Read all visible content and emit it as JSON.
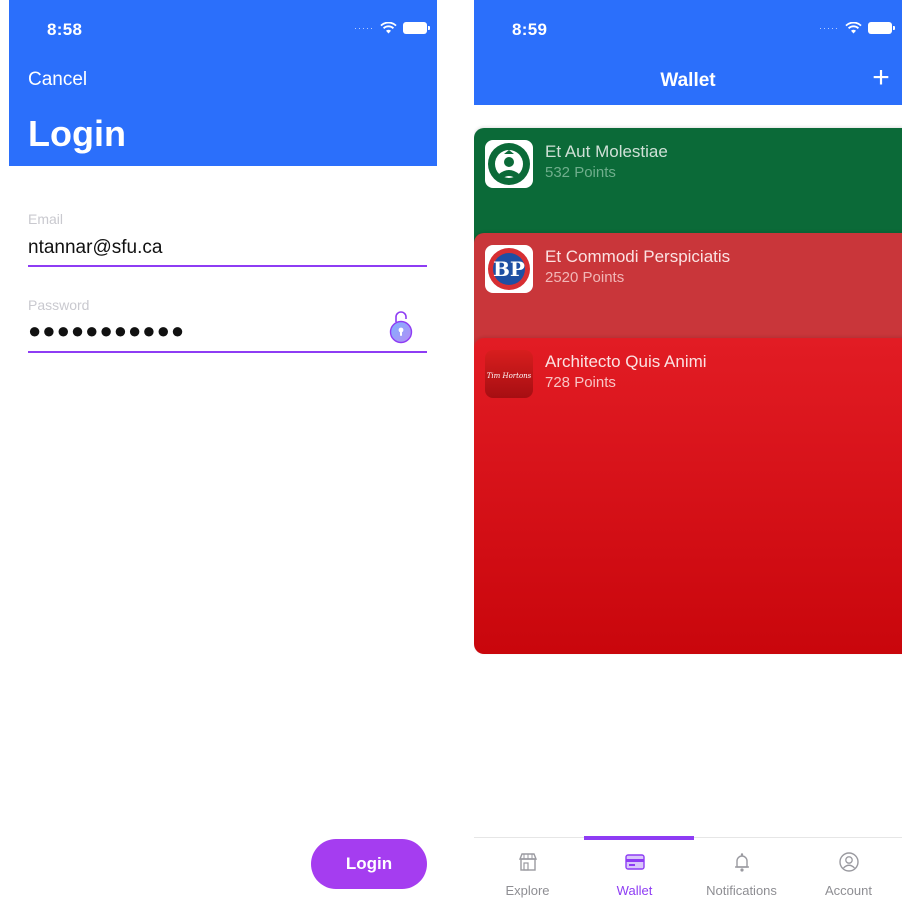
{
  "login_screen": {
    "status_time": "8:58",
    "signal_dots": "·····",
    "cancel_label": "Cancel",
    "title": "Login",
    "email": {
      "label": "Email",
      "value": "ntannar@sfu.ca"
    },
    "password": {
      "label": "Password",
      "value": "●●●●●●●●●●●"
    },
    "login_button_label": "Login"
  },
  "wallet_screen": {
    "status_time": "8:59",
    "signal_dots": "·····",
    "title": "Wallet",
    "add_label": "+",
    "cards": [
      {
        "name": "Et Aut Molestiae",
        "points": "532 Points",
        "brand_icon": "starbucks-logo",
        "color": "#0B6A38"
      },
      {
        "name": "Et Commodi Perspiciatis",
        "points": "2520 Points",
        "brand_icon": "boston-pizza-logo",
        "color": "#C9363A"
      },
      {
        "name": "Architecto Quis Animi",
        "points": "728 Points",
        "brand_icon": "tim-hortons-logo",
        "color": "#E21C24",
        "logo_text": "Tim Hortons"
      }
    ],
    "tabs": [
      {
        "label": "Explore",
        "icon": "storefront-icon",
        "active": false
      },
      {
        "label": "Wallet",
        "icon": "wallet-icon",
        "active": true
      },
      {
        "label": "Notifications",
        "icon": "notifications-icon",
        "active": false
      },
      {
        "label": "Account",
        "icon": "account-icon",
        "active": false
      }
    ]
  },
  "colors": {
    "header_blue": "#2B6FFB",
    "accent_purple": "#8E3CF4",
    "button_purple": "#A53DF0"
  }
}
